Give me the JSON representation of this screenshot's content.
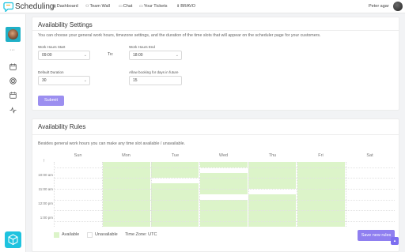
{
  "app": {
    "brand": "Scheduling",
    "user_name": "Peter agar"
  },
  "nav": [
    {
      "label": "Dashboard",
      "icon": "dashboard-icon"
    },
    {
      "label": "Team Wall",
      "icon": "team-icon"
    },
    {
      "label": "Chat",
      "icon": "chat-icon"
    },
    {
      "label": "Your Tickets",
      "icon": "ticket-icon"
    },
    {
      "label": "BRAVO",
      "icon": "download-icon"
    }
  ],
  "sidebar": {
    "dots": "···"
  },
  "settings": {
    "title": "Availability Settings",
    "subtitle": "You can choose your general work hours, timezone settings, and the duration of the time slots that will appear on the scheduler page for your customers.",
    "start_label": "Work Hours Start",
    "start_value": "09:00",
    "to_label": "To:",
    "end_label": "Work Hours End",
    "end_value": "18:00",
    "duration_label": "Default Duration",
    "duration_value": "30",
    "days_label": "Allow booking for days in future",
    "days_value": "15",
    "submit_label": "Submit"
  },
  "rules": {
    "title": "Availability Rules",
    "subtitle": "Besides general work hours you can make any time slot available / unavailable.",
    "days": [
      "Sun",
      "Mon",
      "Tue",
      "Wed",
      "Thu",
      "Fri",
      "Sat"
    ],
    "times": [
      "10:00 am",
      "11:00 am",
      "12:00 pm",
      "1:00 pm"
    ],
    "legend_available": "Available",
    "legend_unavailable": "Unavailable",
    "timezone": "Time Zone: UTC",
    "new_rules_label": "Save new rules",
    "colors": {
      "available": "#dcf4c9",
      "unavailable": "#ffffff",
      "accent": "#8f7ff0"
    }
  }
}
